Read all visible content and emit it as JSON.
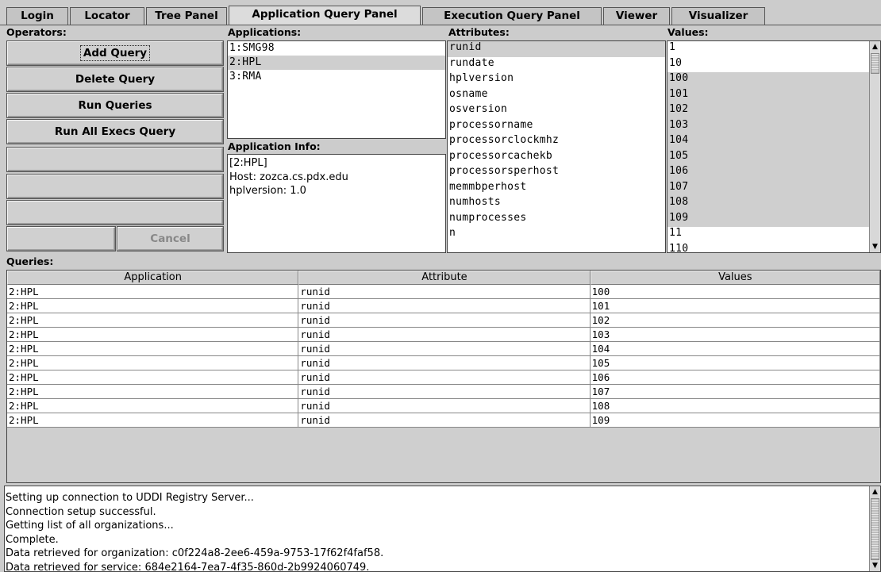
{
  "tabs": [
    {
      "label": "Login"
    },
    {
      "label": "Locator"
    },
    {
      "label": "Tree Panel"
    },
    {
      "label": "Application Query Panel"
    },
    {
      "label": "Execution Query Panel"
    },
    {
      "label": "Viewer"
    },
    {
      "label": "Visualizer"
    }
  ],
  "active_tab": "Application Query Panel",
  "operators": {
    "label": "Operators:",
    "add": "Add Query",
    "delete": "Delete Query",
    "run": "Run Queries",
    "run_all": "Run All Execs Query",
    "cancel": "Cancel"
  },
  "applications": {
    "label": "Applications:",
    "items": [
      "1:SMG98",
      "2:HPL",
      "3:RMA"
    ],
    "selected": "2:HPL"
  },
  "app_info": {
    "label": "Application Info:",
    "lines": [
      "[2:HPL]",
      "Host: zozca.cs.pdx.edu",
      "hplversion: 1.0"
    ]
  },
  "attributes": {
    "label": "Attributes:",
    "items": [
      "runid",
      "rundate",
      "hplversion",
      "osname",
      "osversion",
      "processorname",
      "processorclockmhz",
      "processorcachekb",
      "processorsperhost",
      "memmbperhost",
      "numhosts",
      "numprocesses",
      "n"
    ],
    "selected": "runid"
  },
  "values": {
    "label": "Values:",
    "items": [
      "1",
      "10",
      "100",
      "101",
      "102",
      "103",
      "104",
      "105",
      "106",
      "107",
      "108",
      "109",
      "11",
      "110"
    ],
    "selected": [
      "100",
      "101",
      "102",
      "103",
      "104",
      "105",
      "106",
      "107",
      "108",
      "109"
    ]
  },
  "queries": {
    "label": "Queries:",
    "columns": [
      "Application",
      "Attribute",
      "Values"
    ],
    "rows": [
      [
        "2:HPL",
        "runid",
        "100"
      ],
      [
        "2:HPL",
        "runid",
        "101"
      ],
      [
        "2:HPL",
        "runid",
        "102"
      ],
      [
        "2:HPL",
        "runid",
        "103"
      ],
      [
        "2:HPL",
        "runid",
        "104"
      ],
      [
        "2:HPL",
        "runid",
        "105"
      ],
      [
        "2:HPL",
        "runid",
        "106"
      ],
      [
        "2:HPL",
        "runid",
        "107"
      ],
      [
        "2:HPL",
        "runid",
        "108"
      ],
      [
        "2:HPL",
        "runid",
        "109"
      ]
    ]
  },
  "log": {
    "lines": [
      "Setting up connection to UDDI Registry Server...",
      "Connection setup successful.",
      "Getting list of all organizations...",
      "Complete.",
      "Data retrieved for organization: c0f224a8-2ee6-459a-9753-17f62f4faf58.",
      "Data retrieved for service: 684e2164-7ea7-4f35-860d-2b9924060749."
    ]
  }
}
